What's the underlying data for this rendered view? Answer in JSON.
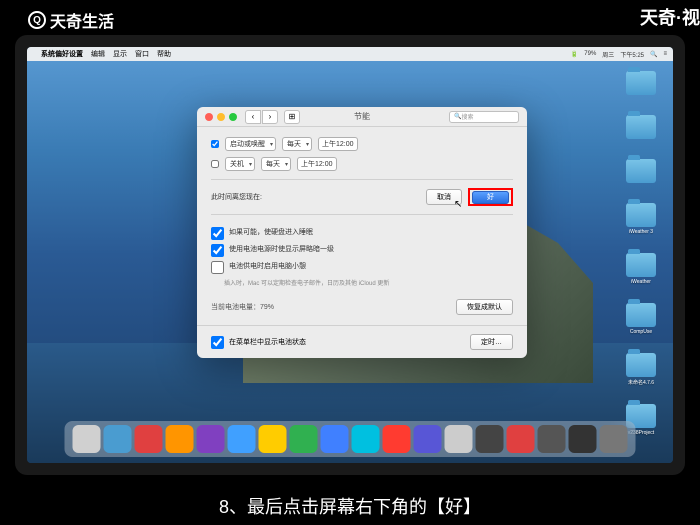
{
  "watermark": {
    "topleft": "天奇生活",
    "topright": "天奇·视"
  },
  "menubar": {
    "apple": "",
    "app": "系统偏好设置",
    "items": [
      "编辑",
      "显示",
      "窗口",
      "帮助"
    ],
    "right": {
      "battery": "79%",
      "day": "周三",
      "time": "下午5:25"
    }
  },
  "desktop": {
    "icons": [
      {
        "label": ""
      },
      {
        "label": ""
      },
      {
        "label": ""
      },
      {
        "label": "iWeather 3"
      },
      {
        "label": "iWeather"
      },
      {
        "label": "CompUse"
      },
      {
        "label": "未命名4.7.6"
      },
      {
        "label": "v238Project"
      }
    ]
  },
  "prefs": {
    "title": "节能",
    "search_placeholder": "搜索",
    "schedule": {
      "startup_check": true,
      "startup_label": "启动或唤醒",
      "startup_freq": "每天",
      "startup_time": "上午12:00",
      "shutdown_check": false,
      "shutdown_label": "关机",
      "shutdown_freq": "每天",
      "shutdown_time": "上午12:00"
    },
    "dialog": {
      "message": "此时间离您现在:",
      "cancel": "取消",
      "ok": "好"
    },
    "options": {
      "opt1": "如果可能，使硬盘进入睡眠",
      "opt2": "使用电池电源时使显示屏略暗一级",
      "opt3": "电池供电时启用电脑小憩",
      "opt3_sub": "插入时，Mac 可以定期检查电子邮件，日历及其他 iCloud 更新"
    },
    "battery_status": "当前电池电量：79%",
    "restore_defaults": "恢复成默认",
    "show_in_menubar_check": true,
    "show_in_menubar": "在菜单栏中显示电池状态",
    "schedule_btn": "定时…"
  },
  "dock_colors": [
    "#d0d0d0",
    "#4a9cd0",
    "#e04040",
    "#ff9500",
    "#8040c0",
    "#40a0ff",
    "#ffcc00",
    "#30b050",
    "#4080ff",
    "#00c0e0",
    "#ff3b30",
    "#5856d6",
    "#ccc",
    "#444",
    "#e04040",
    "#555",
    "#333",
    "#777"
  ],
  "caption": "8、最后点击屏幕右下角的【好】"
}
